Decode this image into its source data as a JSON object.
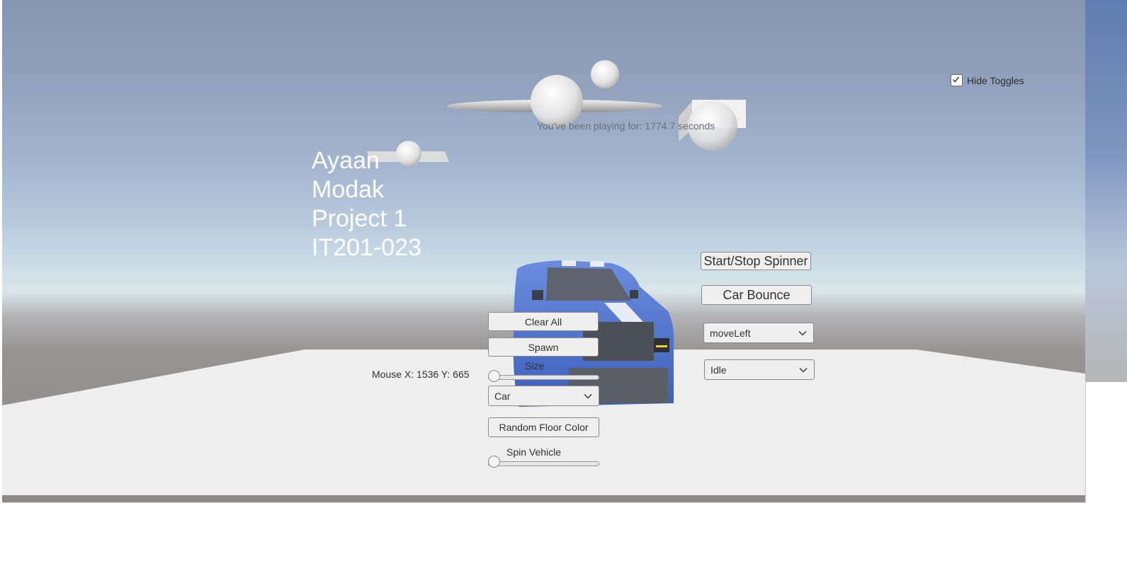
{
  "overlay": {
    "name_lines": [
      "Ayaan",
      "Modak",
      "Project 1",
      "IT201-023"
    ],
    "play_timer": "You've been playing for: 1774.7 seconds",
    "mouse_readout": "Mouse X: 1536 Y: 665"
  },
  "toggles": {
    "hide_toggles_label": "Hide Toggles",
    "hide_toggles_checked": true
  },
  "buttons": {
    "start_stop_spinner": "Start/Stop Spinner",
    "car_bounce": "Car Bounce",
    "clear_all": "Clear All",
    "spawn": "Spawn",
    "random_floor_color": "Random Floor Color"
  },
  "sliders": {
    "size_label": "Size",
    "size_value": 0,
    "spin_vehicle_label": "Spin Vehicle",
    "spin_vehicle_value": 0
  },
  "dropdowns": {
    "spawn_type_selected": "Car",
    "movement_selected": "moveLeft",
    "animation_selected": "Idle"
  },
  "colors": {
    "sky_top": "#8796b0",
    "floor": "#eeeeee",
    "car_body": "#4a6fd0",
    "ui_button_bg": "#efefef"
  }
}
